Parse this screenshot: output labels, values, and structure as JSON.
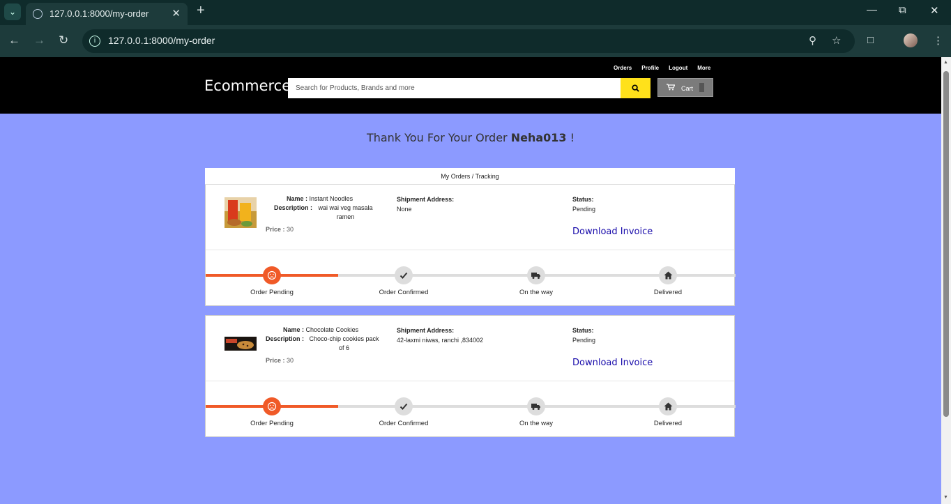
{
  "browser": {
    "tab_title": "127.0.0.1:8000/my-order",
    "url": "127.0.0.1:8000/my-order"
  },
  "header": {
    "brand": "Ecommerce",
    "links": [
      "Orders",
      "Profile",
      "Logout",
      "More"
    ],
    "search_placeholder": "Search for Products, Brands and more",
    "cart_label": "Cart"
  },
  "greeting": {
    "prefix": "Thank You For Your Order",
    "username": "Neha013",
    "suffix": "!"
  },
  "orders_title": "My Orders / Tracking",
  "labels": {
    "name": "Name :",
    "description": "Description :",
    "price": "Price :",
    "shipment": "Shipment Address:",
    "status": "Status:",
    "invoice": "Download Invoice"
  },
  "steps": [
    "Order Pending",
    "Order Confirmed",
    "On the way",
    "Delivered"
  ],
  "orders": [
    {
      "name": "Instant Noodles",
      "description": "wai wai veg masala ramen",
      "price": "30",
      "address": "None",
      "status": "Pending",
      "image": "noodles-product-image"
    },
    {
      "name": "Chocolate Cookies",
      "description": "Choco-chip cookies pack of 6",
      "price": "30",
      "address": "42-laxmi niwas, ranchi ,834002",
      "status": "Pending",
      "image": "cookies-product-image"
    }
  ],
  "colors": {
    "page_bg": "#8c9aff",
    "progress": "#f05a28",
    "search_button": "#ffe11b",
    "link": "#1a0dab"
  }
}
